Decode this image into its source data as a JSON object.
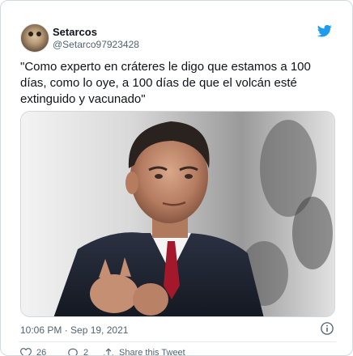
{
  "author": {
    "display_name": "Setarcos",
    "handle": "@Setarco97923428",
    "avatar_icon": "avatar-photo"
  },
  "brand": {
    "icon": "twitter-bird-icon",
    "color": "#1d9bf0"
  },
  "tweet": {
    "text": "\"Como experto en cráteres le digo que estamos a 100 días, como lo oye, a 100 días de que el volcán esté extinguido y vacunado\""
  },
  "media": {
    "description_icon": "photo-man-in-suit"
  },
  "meta": {
    "timestamp": "10:06 PM · Sep 19, 2021",
    "info_icon": "info-icon"
  },
  "actions": {
    "like_count": "26",
    "reply_count": "2",
    "share_label": "Share this Tweet"
  }
}
